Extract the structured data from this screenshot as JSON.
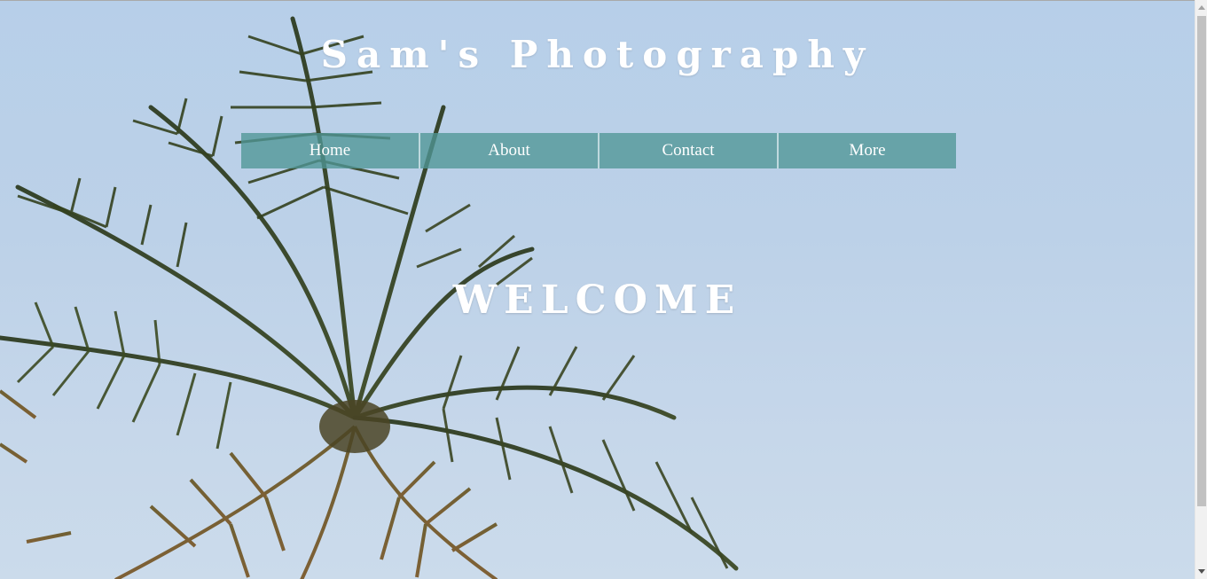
{
  "site": {
    "title": "Sam's Photography",
    "welcome": "WELCOME"
  },
  "nav": {
    "items": [
      {
        "label": "Home"
      },
      {
        "label": "About"
      },
      {
        "label": "Contact"
      },
      {
        "label": "More"
      }
    ]
  },
  "colors": {
    "nav_background": "#5f9ea0",
    "text": "#ffffff",
    "sky": "#bcd1e8"
  },
  "icons": {
    "background": "palm-tree-photo",
    "scroll_up": "triangle-up-icon",
    "scroll_down": "triangle-down-icon"
  }
}
